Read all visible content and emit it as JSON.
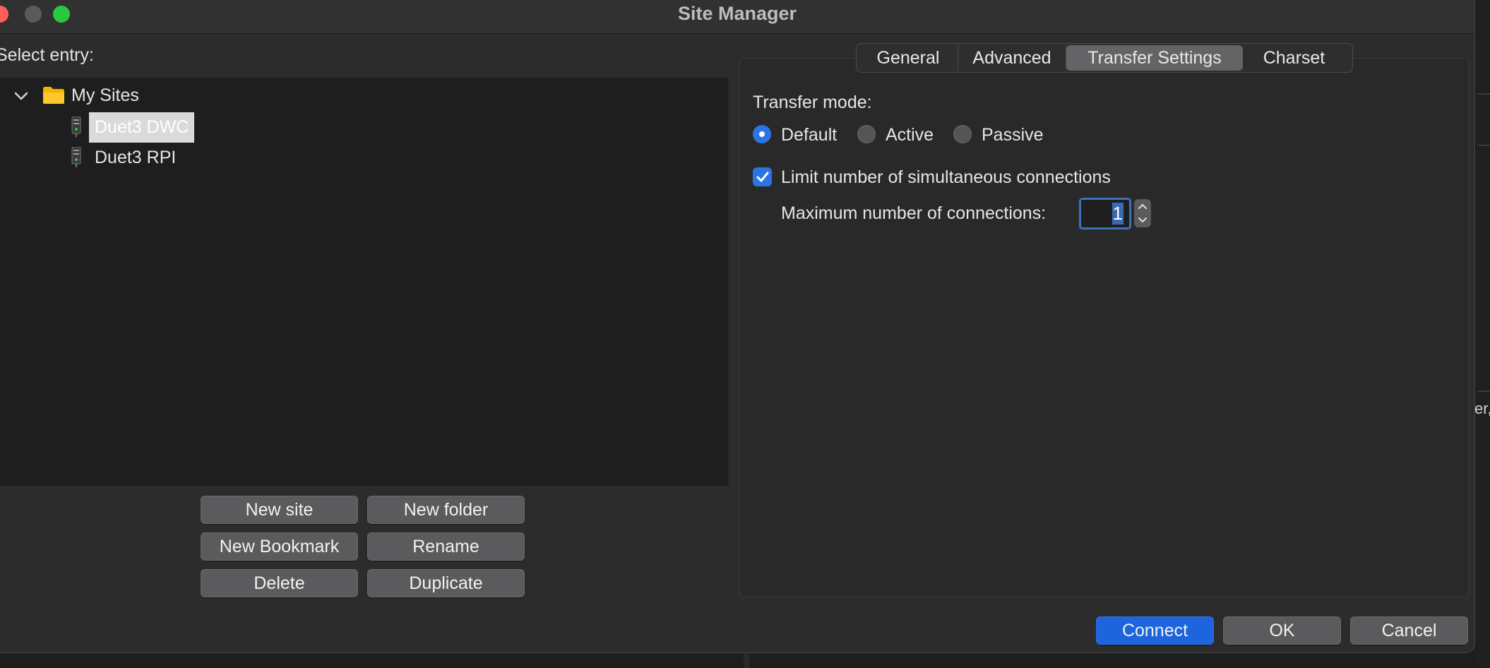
{
  "window": {
    "title": "Site Manager"
  },
  "tree": {
    "select_label": "Select entry:",
    "folder": {
      "label": "My Sites"
    },
    "sites": [
      {
        "label": "Duet3 DWC",
        "selected": true
      },
      {
        "label": "Duet3 RPI",
        "selected": false
      }
    ]
  },
  "actions": {
    "new_site": "New site",
    "new_folder": "New folder",
    "new_bookmark": "New Bookmark",
    "rename": "Rename",
    "delete": "Delete",
    "duplicate": "Duplicate"
  },
  "tabs": [
    {
      "label": "General",
      "active": false
    },
    {
      "label": "Advanced",
      "active": false
    },
    {
      "label": "Transfer Settings",
      "active": true
    },
    {
      "label": "Charset",
      "active": false
    }
  ],
  "transfer": {
    "mode_label": "Transfer mode:",
    "modes": [
      {
        "label": "Default",
        "selected": true
      },
      {
        "label": "Active",
        "selected": false
      },
      {
        "label": "Passive",
        "selected": false
      }
    ],
    "limit_label": "Limit number of simultaneous connections",
    "limit_checked": true,
    "max_label": "Maximum number of connections:",
    "max_value": "1"
  },
  "footer": {
    "connect": "Connect",
    "ok": "OK",
    "cancel": "Cancel"
  },
  "background": {
    "edge_text": "er,"
  },
  "colors": {
    "accent": "#2a74e6",
    "window": "#2d2c2d",
    "tree_bg": "#1e1e1e"
  }
}
